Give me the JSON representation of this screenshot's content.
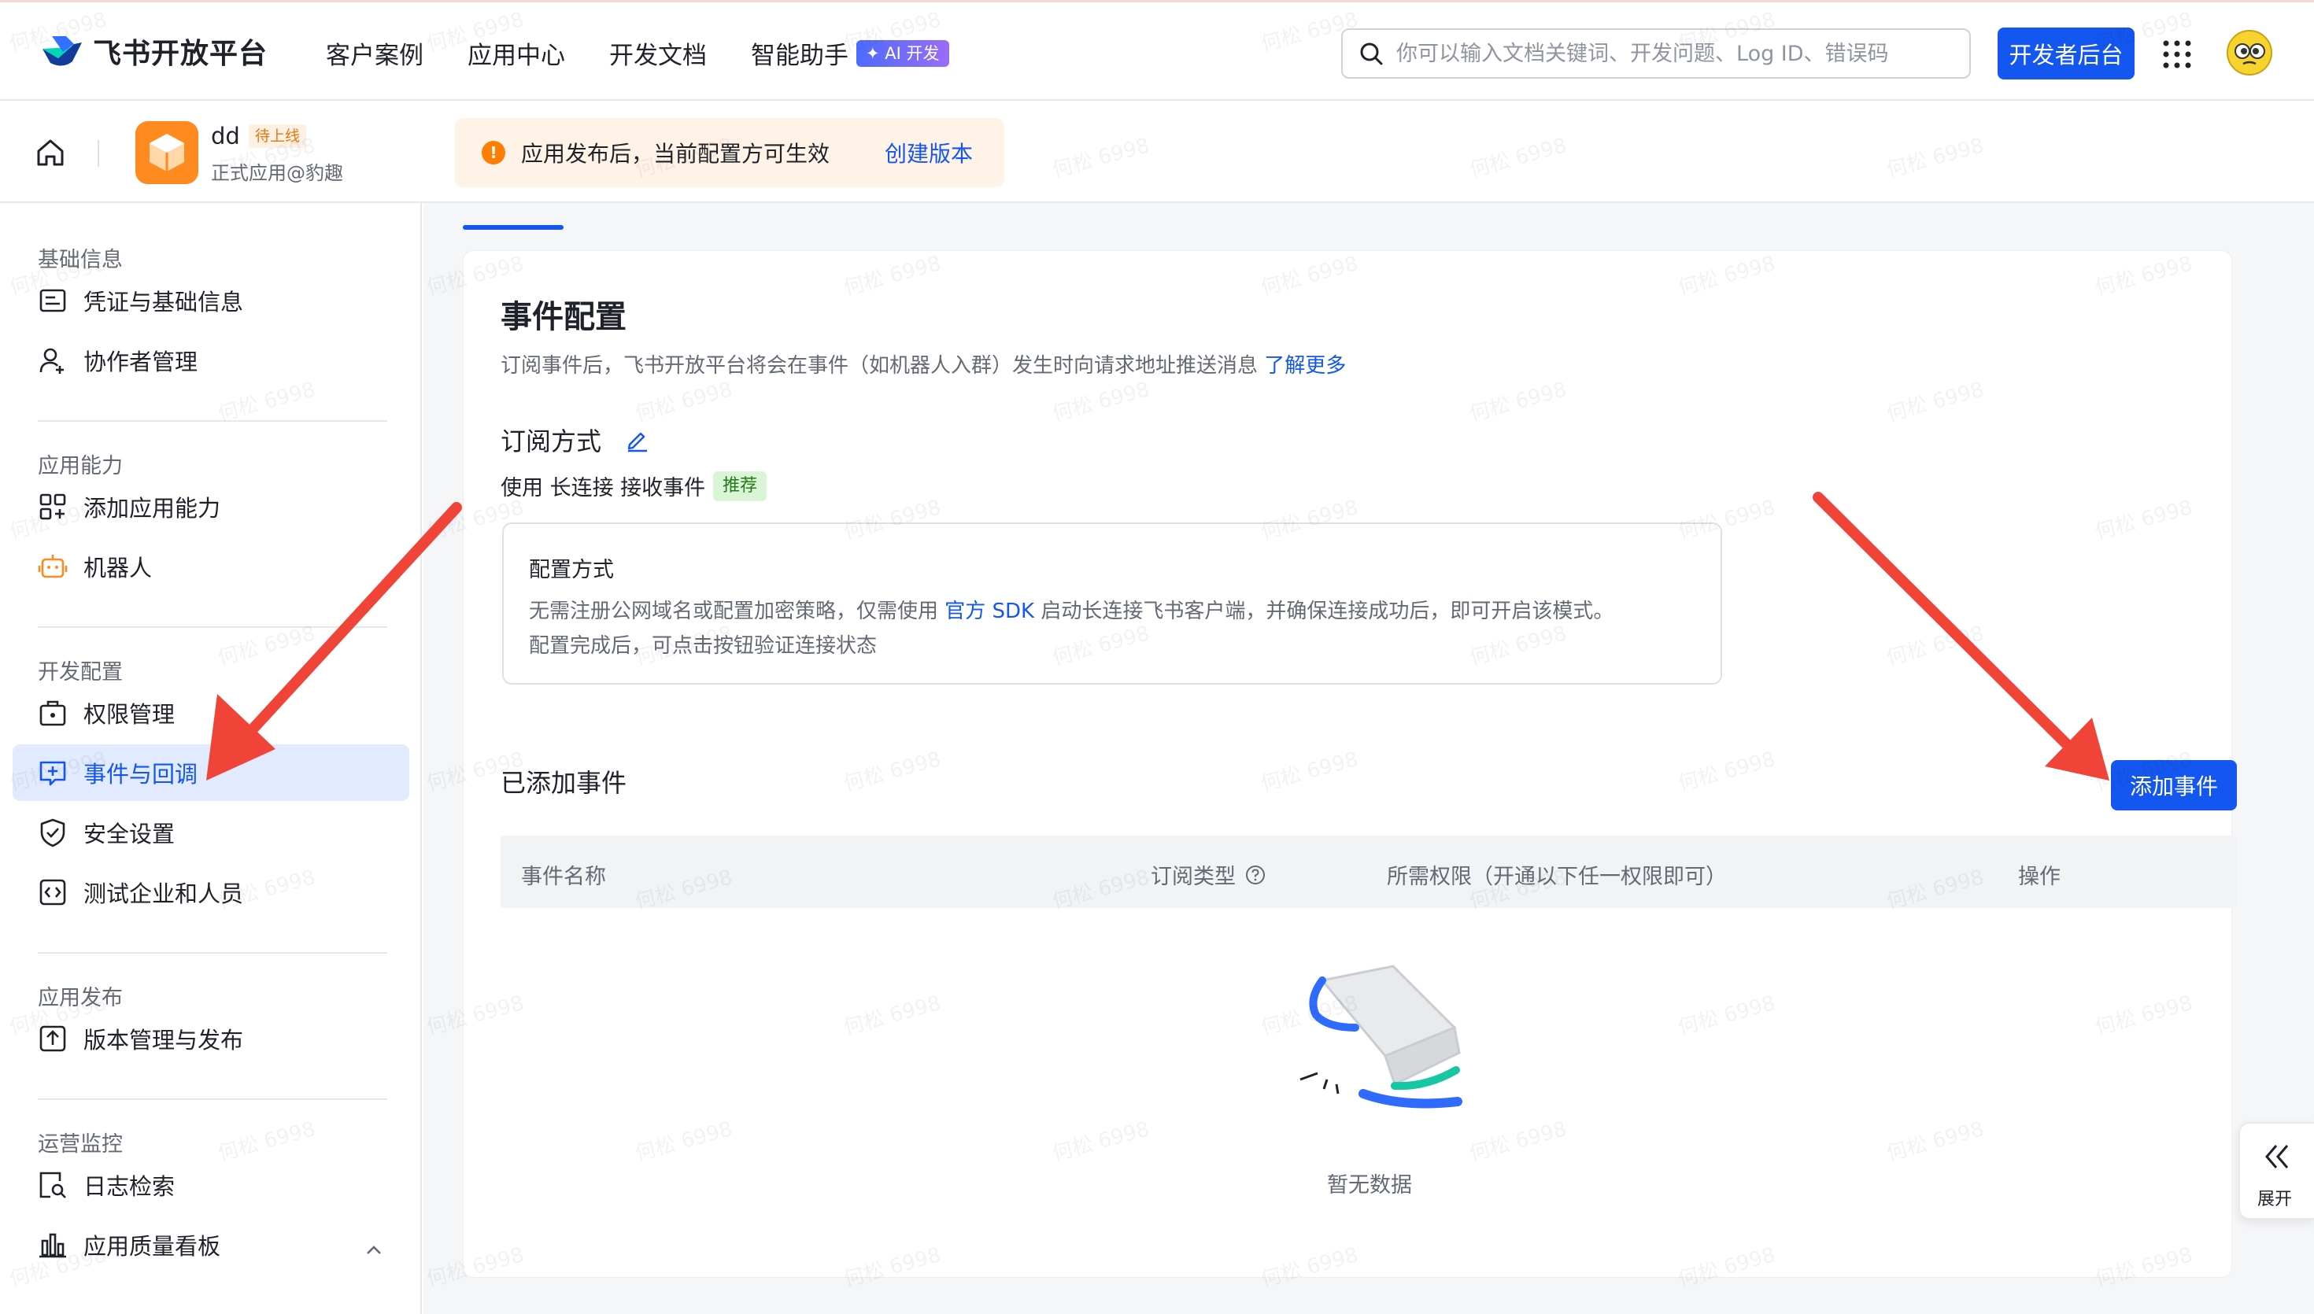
{
  "header": {
    "brand": "飞书开放平台",
    "nav": [
      "客户案例",
      "应用中心",
      "开发文档",
      "智能助手"
    ],
    "ai_badge": "✦ AI 开发",
    "search_placeholder": "你可以输入文档关键词、开发问题、Log ID、错误码",
    "dev_console": "开发者后台"
  },
  "app": {
    "name": "dd",
    "status": "待上线",
    "subtitle": "正式应用@豹趣",
    "notice": "应用发布后，当前配置方可生效",
    "notice_link": "创建版本"
  },
  "sidebar": {
    "sections": [
      {
        "title": "基础信息",
        "items": [
          "凭证与基础信息",
          "协作者管理"
        ]
      },
      {
        "title": "应用能力",
        "items": [
          "添加应用能力",
          "机器人"
        ]
      },
      {
        "title": "开发配置",
        "items": [
          "权限管理",
          "事件与回调",
          "安全设置",
          "测试企业和人员"
        ]
      },
      {
        "title": "应用发布",
        "items": [
          "版本管理与发布"
        ]
      },
      {
        "title": "运营监控",
        "items": [
          "日志检索",
          "应用质量看板"
        ]
      }
    ],
    "active": "事件与回调"
  },
  "content": {
    "title": "事件配置",
    "desc": "订阅事件后，飞书开放平台将会在事件（如机器人入群）发生时向请求地址推送消息",
    "desc_link": "了解更多",
    "subscribe_title": "订阅方式",
    "subscribe_line": "使用 长连接 接收事件",
    "recommend_tag": "推荐",
    "config_title": "配置方式",
    "config_line1_a": "无需注册公网域名或配置加密策略，仅需使用 ",
    "config_line1_link": "官方 SDK",
    "config_line1_b": " 启动长连接飞书客户端，并确保连接成功后，即可开启该模式。",
    "config_line2": "配置完成后，可点击按钮验证连接状态",
    "added_title": "已添加事件",
    "add_button": "添加事件",
    "columns": [
      "事件名称",
      "订阅类型",
      "所需权限（开通以下任一权限即可）",
      "操作"
    ],
    "empty": "暂无数据"
  },
  "expand": "展开",
  "watermark": "何松 6998",
  "colors": {
    "primary": "#1456f0",
    "arrow": "#f04438",
    "active_bg": "#e1eaff",
    "orange": "#ff8a1f"
  }
}
